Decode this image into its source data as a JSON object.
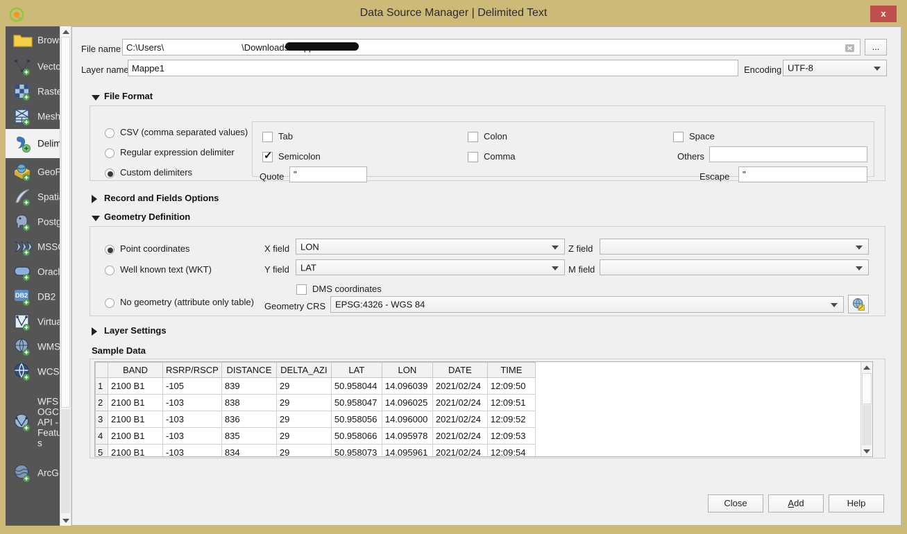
{
  "window": {
    "title": "Data Source Manager | Delimited Text",
    "close_label": "x",
    "titlebar_color": "#cdba78",
    "close_color": "#c0504d"
  },
  "sidebar": {
    "items": [
      {
        "label": "Browser",
        "icon": "folder-icon",
        "selected": false
      },
      {
        "label": "Vector",
        "icon": "vector-icon",
        "selected": false
      },
      {
        "label": "Raster",
        "icon": "raster-icon",
        "selected": false
      },
      {
        "label": "Mesh",
        "icon": "mesh-icon",
        "selected": false
      },
      {
        "label": "Delimited Text",
        "icon": "delimited-text-icon",
        "selected": true
      },
      {
        "label": "GeoPackage",
        "icon": "geopackage-icon",
        "selected": false
      },
      {
        "label": "SpatiaLite",
        "icon": "spatialite-icon",
        "selected": false
      },
      {
        "label": "PostgreSQL",
        "icon": "postgres-icon",
        "selected": false
      },
      {
        "label": "MSSQL",
        "icon": "mssql-icon",
        "selected": false
      },
      {
        "label": "Oracle",
        "icon": "oracle-icon",
        "selected": false
      },
      {
        "label": "DB2",
        "icon": "db2-icon",
        "selected": false
      },
      {
        "label": "Virtual Layer",
        "icon": "virtual-layer-icon",
        "selected": false
      },
      {
        "label": "WMS/WMTS",
        "icon": "wms-icon",
        "selected": false
      },
      {
        "label": "WCS",
        "icon": "wcs-icon",
        "selected": false
      },
      {
        "label": "WFS / OGC API - Features",
        "icon": "wfs-icon",
        "selected": false
      },
      {
        "label": "ArcGIS REST Server",
        "icon": "arcgis-icon",
        "selected": false
      }
    ]
  },
  "file_row": {
    "label": "File name",
    "value": "C:\\Users\\\\Downloads\\Mappe1.csv",
    "value_prefix": "C:\\Users\\",
    "value_suffix": "\\Downloads\\Mappe1.csv",
    "clear_icon": "clear-icon",
    "browse_label": "..."
  },
  "layer_row": {
    "label": "Layer name",
    "value": "Mappe1",
    "encoding_label": "Encoding",
    "encoding_value": "UTF-8"
  },
  "file_format": {
    "title": "File Format",
    "expanded": true,
    "type_options": [
      {
        "label": "CSV (comma separated values)",
        "selected": false
      },
      {
        "label": "Regular expression delimiter",
        "selected": false
      },
      {
        "label": "Custom delimiters",
        "selected": true
      }
    ],
    "delimiters": [
      {
        "label": "Tab",
        "checked": false
      },
      {
        "label": "Semicolon",
        "checked": true
      },
      {
        "label": "Colon",
        "checked": false
      },
      {
        "label": "Comma",
        "checked": false
      },
      {
        "label": "Space",
        "checked": false
      }
    ],
    "quote_label": "Quote",
    "quote_value": "\"",
    "others_label": "Others",
    "others_value": "",
    "escape_label": "Escape",
    "escape_value": "\""
  },
  "record_fields": {
    "title": "Record and Fields Options",
    "expanded": false
  },
  "geometry": {
    "title": "Geometry Definition",
    "expanded": true,
    "options": [
      {
        "label": "Point coordinates",
        "selected": true
      },
      {
        "label": "Well known text (WKT)",
        "selected": false
      },
      {
        "label": "No geometry (attribute only table)",
        "selected": false
      }
    ],
    "x_field_label": "X field",
    "x_field_value": "LON",
    "y_field_label": "Y field",
    "y_field_value": "LAT",
    "z_field_label": "Z field",
    "z_field_value": "",
    "m_field_label": "M field",
    "m_field_value": "",
    "dms_label": "DMS coordinates",
    "dms_checked": false,
    "crs_label": "Geometry CRS",
    "crs_value": "EPSG:4326 - WGS 84",
    "crs_button_icon": "crs-globe-icon"
  },
  "layer_settings": {
    "title": "Layer Settings",
    "expanded": false
  },
  "sample_data": {
    "title": "Sample Data",
    "columns": [
      "BAND",
      "RSRP/RSCP",
      "DISTANCE",
      "DELTA_AZI",
      "LAT",
      "LON",
      "DATE",
      "TIME"
    ],
    "rows": [
      {
        "num": "1",
        "cells": [
          "2100 B1",
          "-105",
          "839",
          "29",
          "50.958044",
          "14.096039",
          "2021/02/24",
          "12:09:50"
        ]
      },
      {
        "num": "2",
        "cells": [
          "2100 B1",
          "-103",
          "838",
          "29",
          "50.958047",
          "14.096025",
          "2021/02/24",
          "12:09:51"
        ]
      },
      {
        "num": "3",
        "cells": [
          "2100 B1",
          "-103",
          "836",
          "29",
          "50.958056",
          "14.096000",
          "2021/02/24",
          "12:09:52"
        ]
      },
      {
        "num": "4",
        "cells": [
          "2100 B1",
          "-103",
          "835",
          "29",
          "50.958066",
          "14.095978",
          "2021/02/24",
          "12:09:53"
        ]
      },
      {
        "num": "5",
        "cells": [
          "2100 B1",
          "-103",
          "834",
          "29",
          "50.958073",
          "14.095961",
          "2021/02/24",
          "12:09:54"
        ]
      }
    ]
  },
  "buttons": {
    "close": "Close",
    "add": "Add",
    "add_mnemonic": "A",
    "add_rest": "dd",
    "help": "Help"
  }
}
